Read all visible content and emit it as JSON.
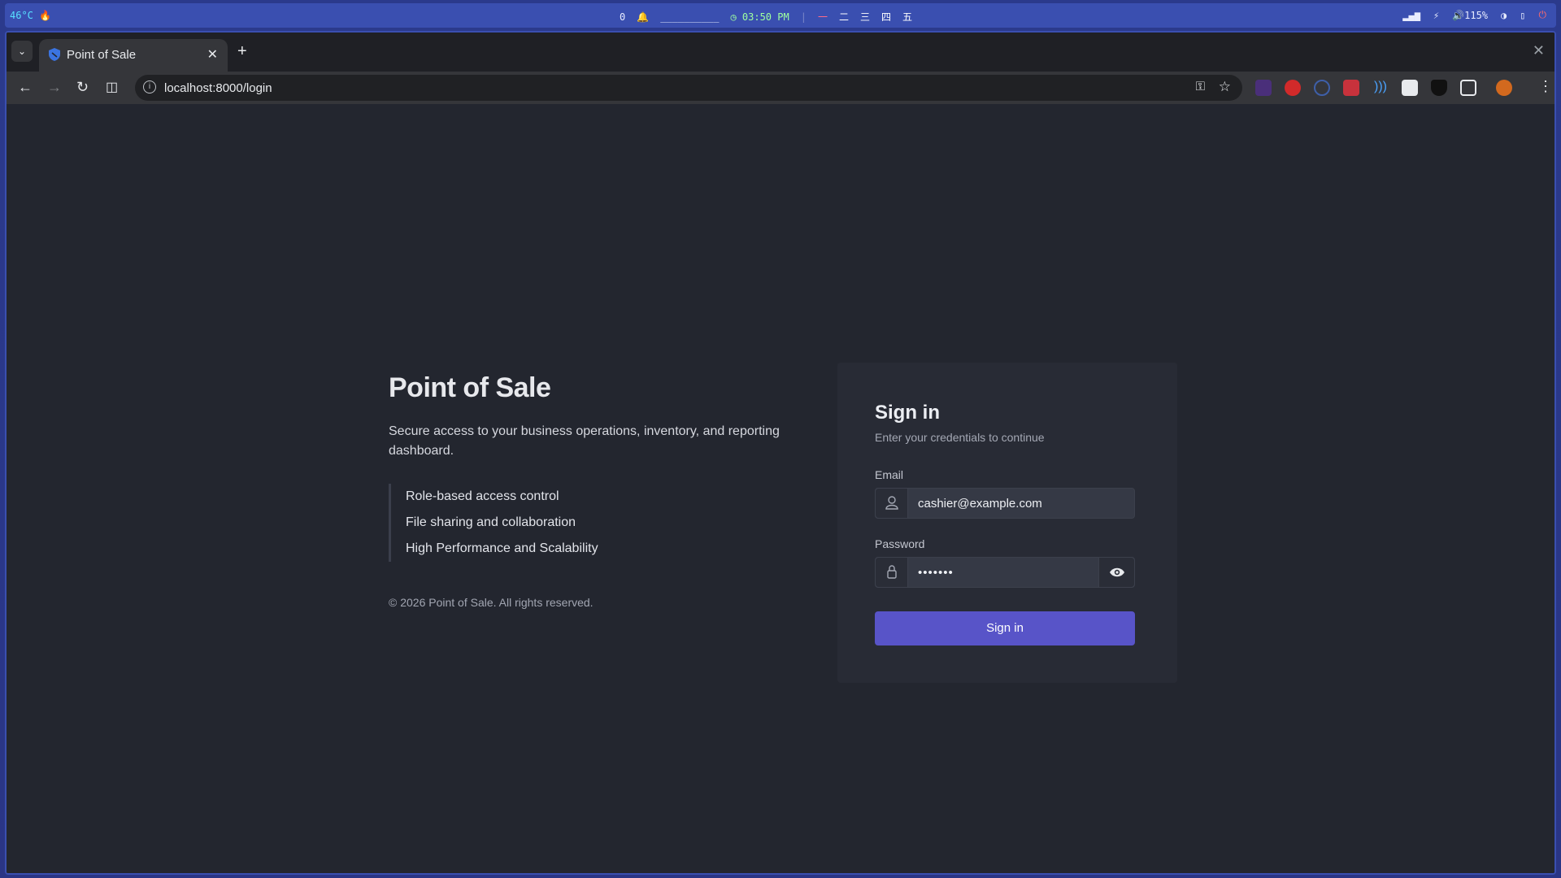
{
  "system_bar": {
    "temperature": "46°C",
    "notifications_count": "0",
    "placeholder_line": "__________",
    "clock": "03:50 PM",
    "workspaces": [
      "一",
      "二",
      "三",
      "四",
      "五"
    ],
    "volume": "115%"
  },
  "browser": {
    "tab": {
      "title": "Point of Sale"
    },
    "address_bar": {
      "url": "localhost:8000/login"
    }
  },
  "hero": {
    "title": "Point of Sale",
    "lead": "Secure access to your business operations, inventory, and reporting dashboard.",
    "features": [
      "Role-based access control",
      "File sharing and collaboration",
      "High Performance and Scalability"
    ],
    "copyright": "© 2026 Point of Sale. All rights reserved."
  },
  "signin": {
    "title": "Sign in",
    "subtitle": "Enter your credentials to continue",
    "email_label": "Email",
    "email_value": "cashier@example.com",
    "password_label": "Password",
    "password_value": "•••••••",
    "submit_label": "Sign in"
  },
  "colors": {
    "accent": "#5854c8",
    "page_bg": "#23262f",
    "card_bg": "#282b35"
  }
}
